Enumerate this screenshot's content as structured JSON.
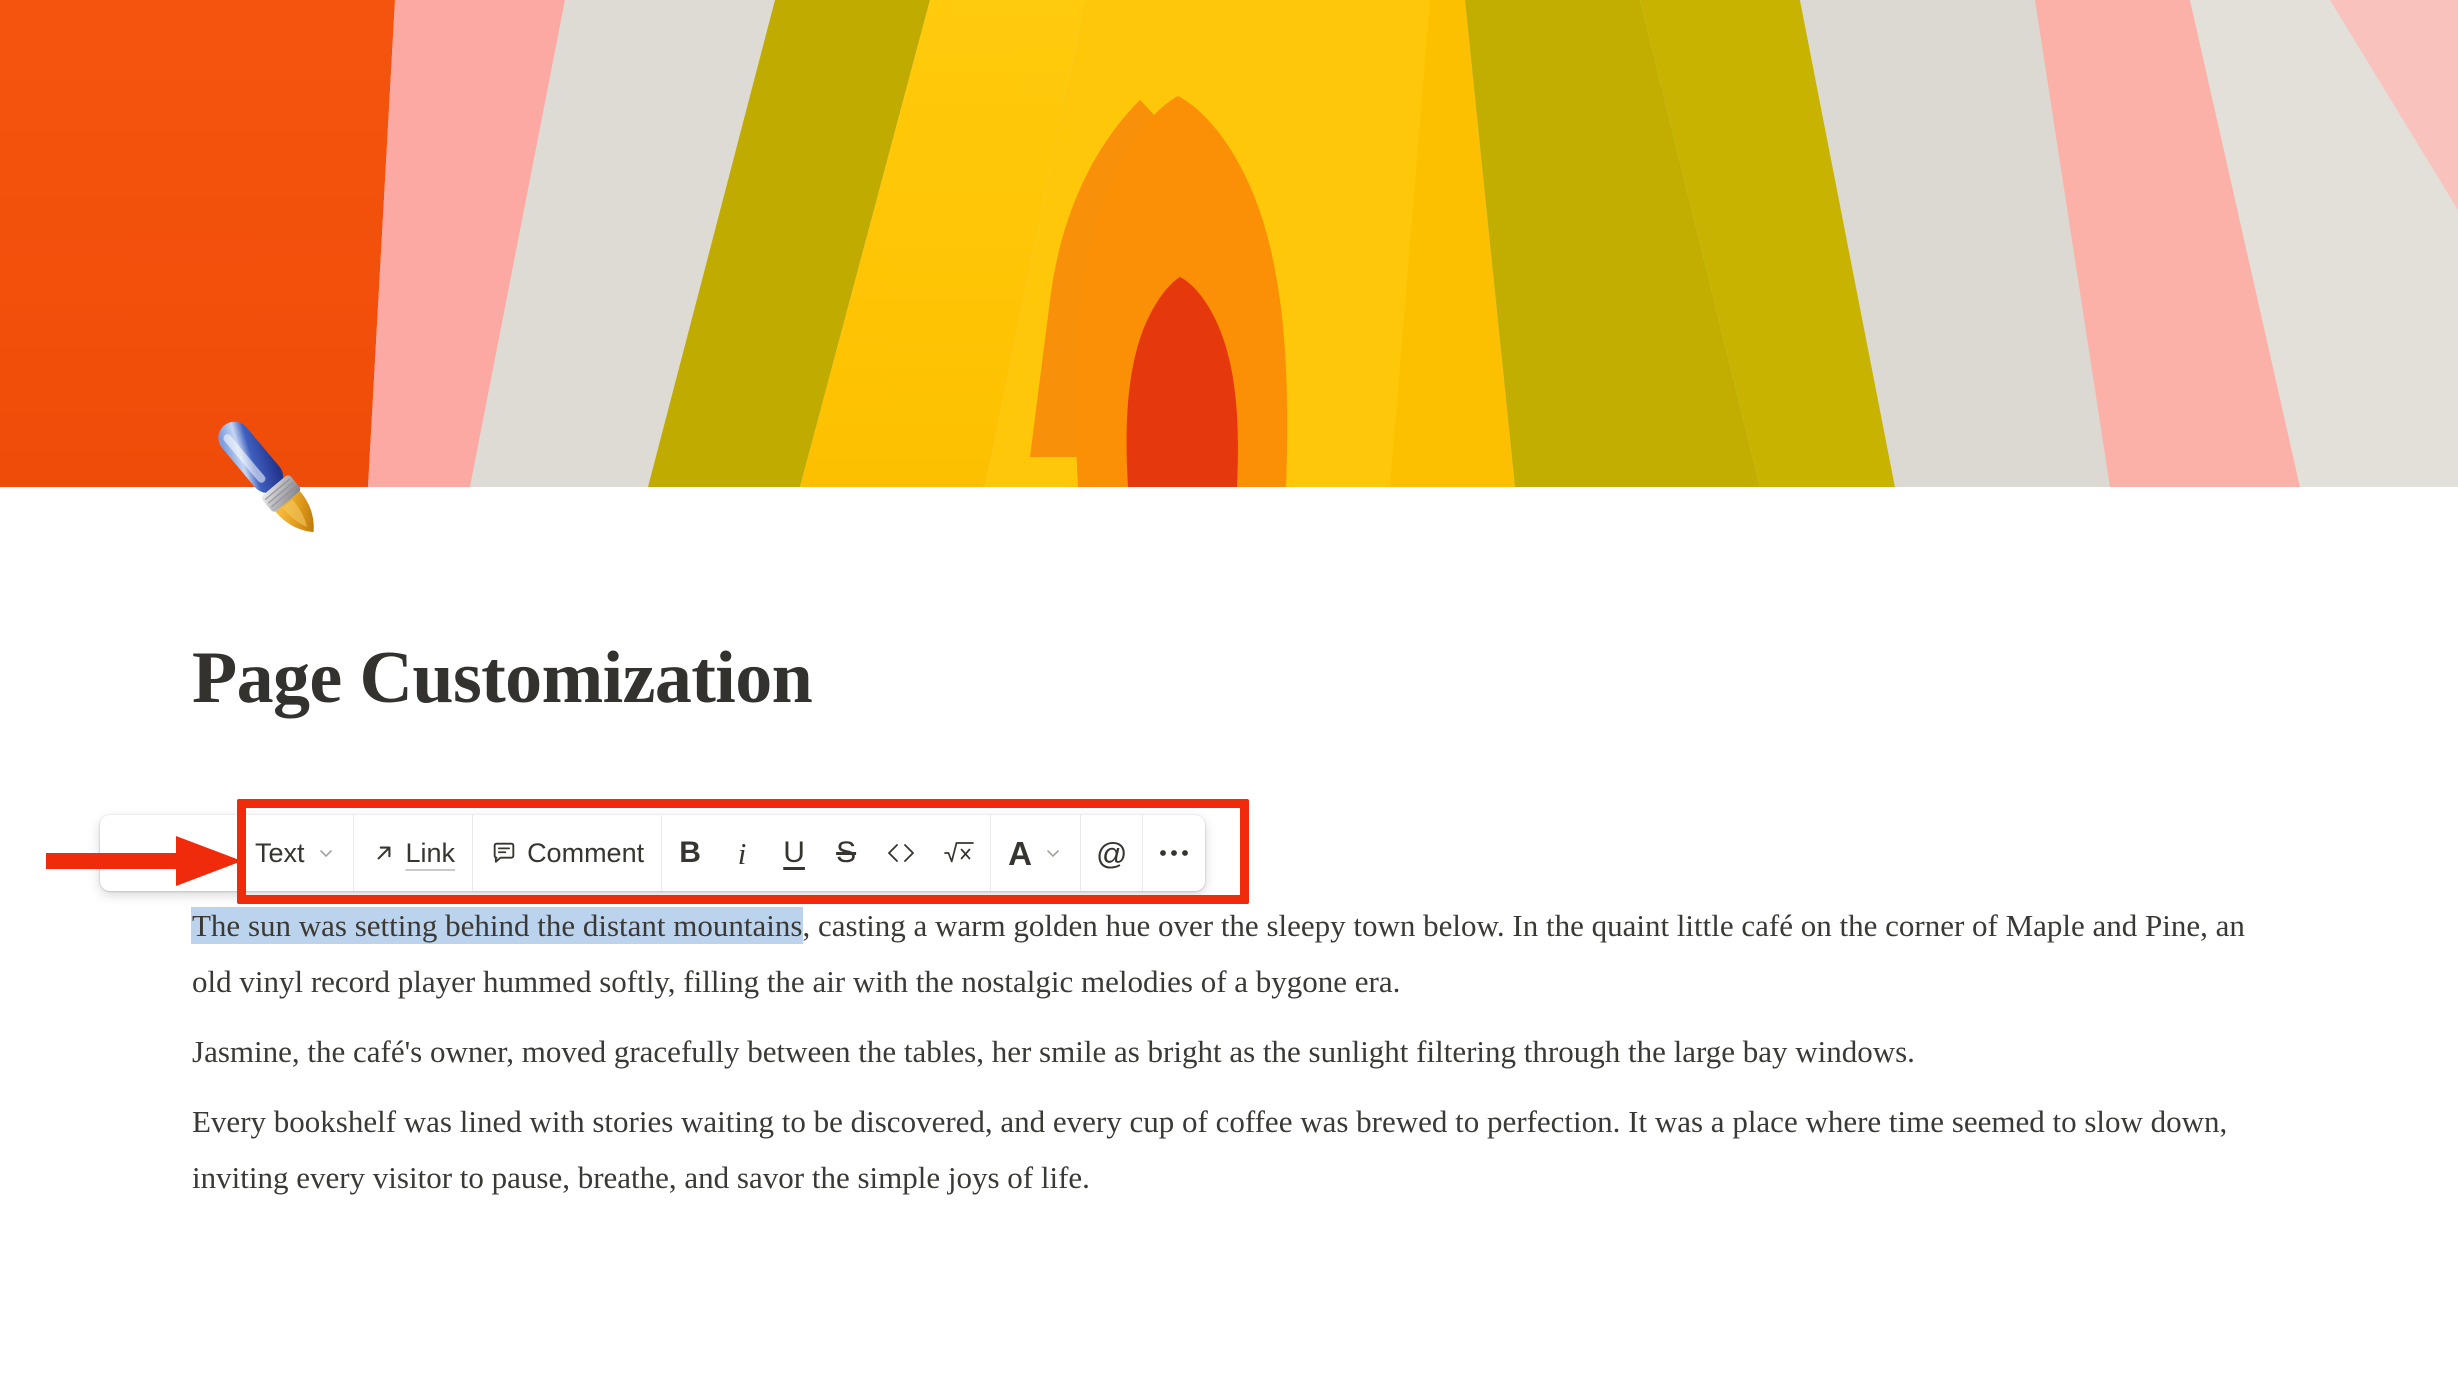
{
  "cover": {
    "icon_name": "paintbrush-emoji",
    "alt": "abstract concentric arch mural in orange, yellow, olive, pink and grey",
    "palette": {
      "orange_deep": "#f2520c",
      "orange_bright": "#fb8c05",
      "orange_mid": "#fc9a05",
      "yellow": "#ffc70a",
      "yellow_warm": "#fdc400",
      "olive": "#c4b000",
      "olive_dark": "#b4a400",
      "pink": "#fba9a2",
      "pink_light": "#fdbdb7",
      "grey": "#dcd9d3",
      "grey_light": "#e2ded8",
      "red_core": "#e5380d"
    }
  },
  "page": {
    "title": "Page Customization"
  },
  "toolbar": {
    "text_style_label": "Text",
    "link_label": "Link",
    "comment_label": "Comment",
    "bold_label": "B",
    "italic_label": "i",
    "underline_label": "U",
    "strikethrough_label": "S",
    "code_label": "<>",
    "equation_label": "√x",
    "color_label": "A",
    "mention_label": "@",
    "more_label": "•••"
  },
  "content": {
    "paragraph_1_selected": "The sun was setting behind the distant mountains",
    "paragraph_1_rest": ", casting a warm golden hue over the sleepy town below. In the quaint little café on the corner of Maple and Pine, an old vinyl record player hummed softly, filling the air with the nostalgic melodies of a bygone era.",
    "paragraph_2": "Jasmine, the café's owner, moved gracefully between the tables, her smile as bright as the sunlight filtering through the large bay windows.",
    "paragraph_3": "Every bookshelf was lined with stories waiting to be discovered, and every cup of coffee was brewed to perfection. It was a place where time seemed to slow down, inviting every visitor to pause, breathe, and savor the simple joys of life."
  },
  "annotations": {
    "highlight_color": "#ef2b0b",
    "arrow_color": "#ef2b0b",
    "selection_color": "#bcd3ee"
  }
}
